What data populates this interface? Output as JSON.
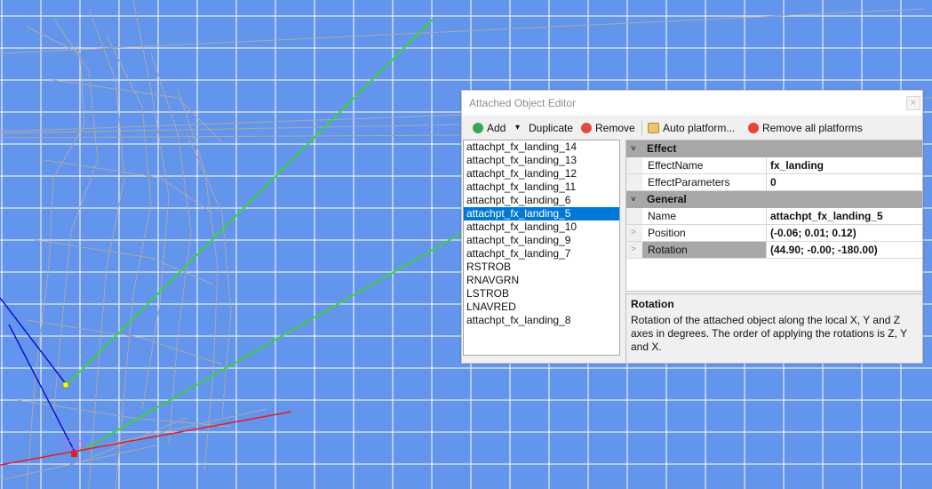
{
  "viewport": {
    "background": "#6495ed",
    "grid_color": "#ffffff",
    "mesh_color": "#a9a9a9"
  },
  "window": {
    "title": "Attached Object Editor",
    "close_glyph": "×"
  },
  "toolbar": {
    "add": {
      "label": "Add",
      "icon": "add-icon",
      "color": "#34a853"
    },
    "dropdown_glyph": "▾",
    "duplicate": {
      "label": "Duplicate"
    },
    "remove": {
      "label": "Remove",
      "icon": "remove-icon",
      "color": "#e34c3c"
    },
    "auto_platform": {
      "label": "Auto platform...",
      "icon": "package-icon"
    },
    "remove_all": {
      "label": "Remove all platforms",
      "icon": "red-dot-icon",
      "color": "#e8442e"
    }
  },
  "object_list": {
    "items": [
      "attachpt_fx_landing_14",
      "attachpt_fx_landing_13",
      "attachpt_fx_landing_12",
      "attachpt_fx_landing_11",
      "attachpt_fx_landing_6",
      "attachpt_fx_landing_5",
      "attachpt_fx_landing_10",
      "attachpt_fx_landing_9",
      "attachpt_fx_landing_7",
      "RSTROB",
      "RNAVGRN",
      "LSTROB",
      "LNAVRED",
      "attachpt_fx_landing_8"
    ],
    "selected_index": 5,
    "selection_color": "#0078d7"
  },
  "properties": {
    "chevron_glyph": "˅",
    "expand_glyph": ">",
    "categories": [
      {
        "name": "Effect",
        "rows": [
          {
            "name": "EffectName",
            "value": "fx_landing"
          },
          {
            "name": "EffectParameters",
            "value": "0"
          }
        ]
      },
      {
        "name": "General",
        "rows": [
          {
            "name": "Name",
            "value": "attachpt_fx_landing_5"
          },
          {
            "name": "Position",
            "value": "(-0.06; 0.01; 0.12)"
          },
          {
            "name": "Rotation",
            "value": "(44.90; -0.00; -180.00)"
          }
        ]
      }
    ]
  },
  "description": {
    "title": "Rotation",
    "text": "Rotation of the attached object along the local X, Y and Z axes in degrees. The order of applying the rotations is Z, Y and X."
  }
}
